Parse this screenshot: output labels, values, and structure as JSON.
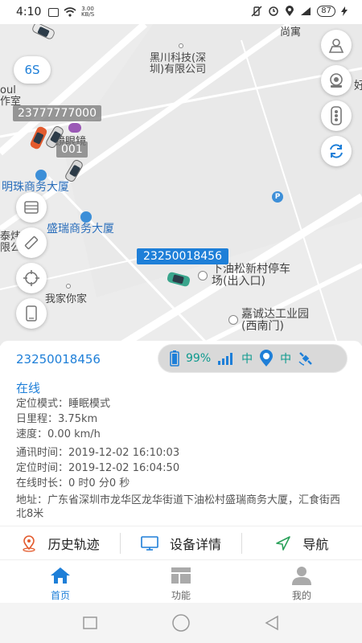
{
  "status_bar": {
    "time": "4:10",
    "net_speed_top": "3.00",
    "net_speed_bottom": "KB/S",
    "battery": "87"
  },
  "map": {
    "zoom_chip": "6S",
    "labels": [
      "尚寓",
      "黑川科技(深",
      "圳)有限公司",
      "oul",
      "作室",
      "镜眼镜",
      "明珠商务大厦",
      "盛瑞商务大厦",
      "泰炜",
      "限公",
      "我家你家",
      "下油松新村停车",
      "场(出入口)",
      "嘉诚达工业园",
      "(西南门)",
      "好"
    ],
    "tags": {
      "tag1": "23777777000",
      "tag2": "001",
      "tag3": "23250018456"
    }
  },
  "panel": {
    "device_id": "23250018456",
    "battery_percent": "99%",
    "signal_level": "中",
    "gps_level": "中",
    "status": "在线",
    "rows": [
      {
        "label": "定位模式：",
        "value": "睡眠模式"
      },
      {
        "label": "日里程：",
        "value": "3.75km"
      },
      {
        "label": "速度：",
        "value": "0.00 km/h"
      },
      {
        "label": "通讯时间：",
        "value": "2019-12-02 16:10:03"
      },
      {
        "label": "定位时间：",
        "value": "2019-12-02 16:04:50"
      },
      {
        "label": "在线时长：",
        "value": "0 时0 分0 秒"
      }
    ],
    "address_label": "地址：",
    "address": "广东省深圳市龙华区龙华街道下油松村盛瑞商务大厦，汇食街西北8米",
    "actions": {
      "history": "历史轨迹",
      "details": "设备详情",
      "navigate": "导航"
    }
  },
  "nav": {
    "home": "首页",
    "functions": "功能",
    "mine": "我的"
  },
  "colors": {
    "accent": "#1e7fd8",
    "signal": "#0e9a8e",
    "map_bg": "#ececec"
  }
}
